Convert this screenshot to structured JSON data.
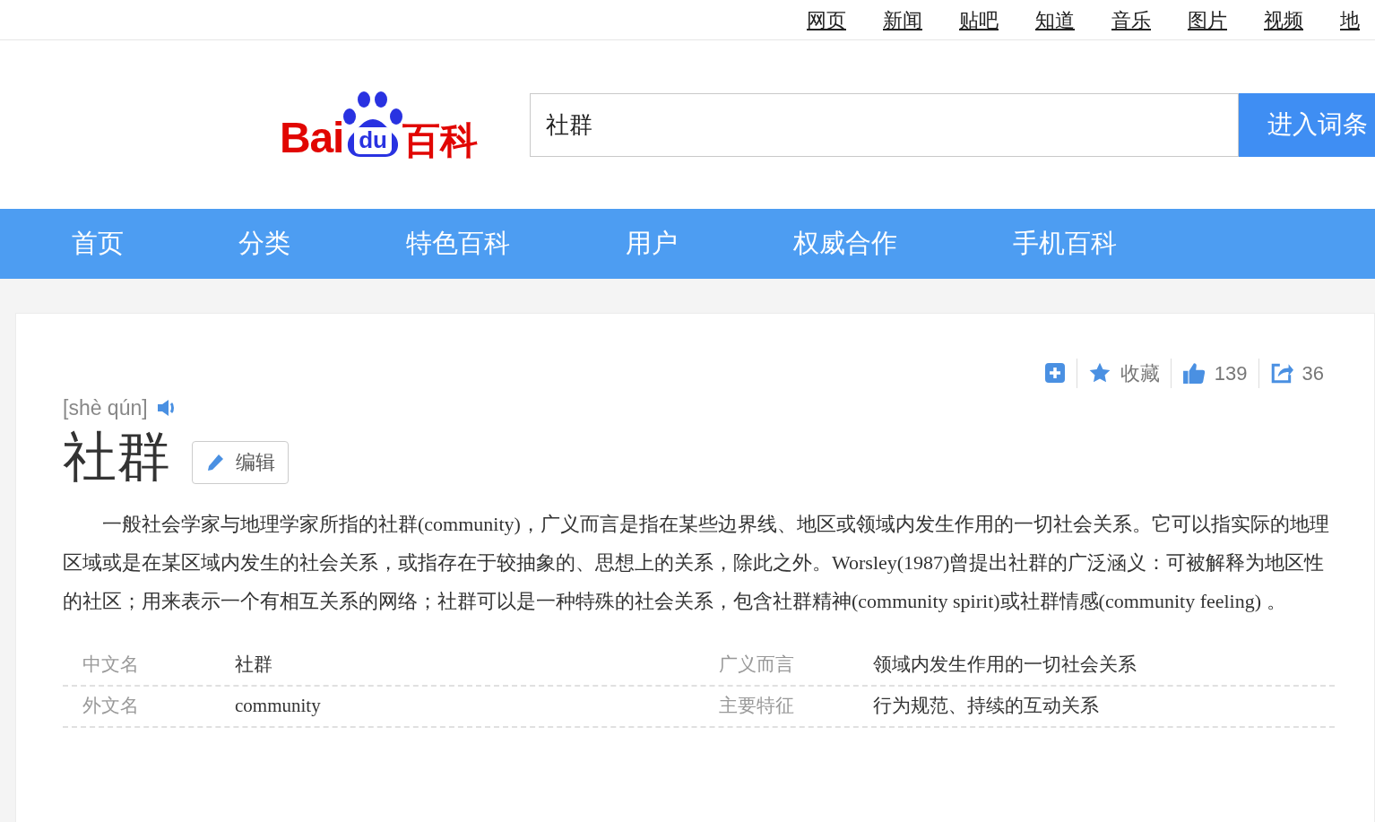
{
  "top_links": [
    "网页",
    "新闻",
    "贴吧",
    "知道",
    "音乐",
    "图片",
    "视频",
    "地"
  ],
  "logo": {
    "prefix": "Bai",
    "paw_text": "du",
    "suffix": "百科"
  },
  "search": {
    "value": "社群",
    "button": "进入词条"
  },
  "nav": [
    "首页",
    "分类",
    "特色百科",
    "用户",
    "权威合作",
    "手机百科"
  ],
  "actions": [
    {
      "kind": "add"
    },
    {
      "kind": "favorite",
      "label": "收藏"
    },
    {
      "kind": "like",
      "label": "139"
    },
    {
      "kind": "share",
      "label": "36"
    }
  ],
  "entry": {
    "pinyin": "[shè qún]",
    "title": "社群",
    "edit_button": "编辑",
    "summary": "一般社会学家与地理学家所指的社群(community)，广义而言是指在某些边界线、地区或领域内发生作用的一切社会关系。它可以指实际的地理区域或是在某区域内发生的社会关系，或指存在于较抽象的、思想上的关系，除此之外。Worsley(1987)曾提出社群的广泛涵义：可被解释为地区性的社区；用来表示一个有相互关系的网络；社群可以是一种特殊的社会关系，包含社群精神(community spirit)或社群情感(community feeling) 。"
  },
  "info_rows": [
    {
      "label_1": "中文名",
      "value_1": "社群",
      "label_2": "广义而言",
      "value_2": "领域内发生作用的一切社会关系"
    },
    {
      "label_1": "外文名",
      "value_1": "community",
      "label_2": "主要特征",
      "value_2": "行为规范、持续的互动关系"
    }
  ]
}
